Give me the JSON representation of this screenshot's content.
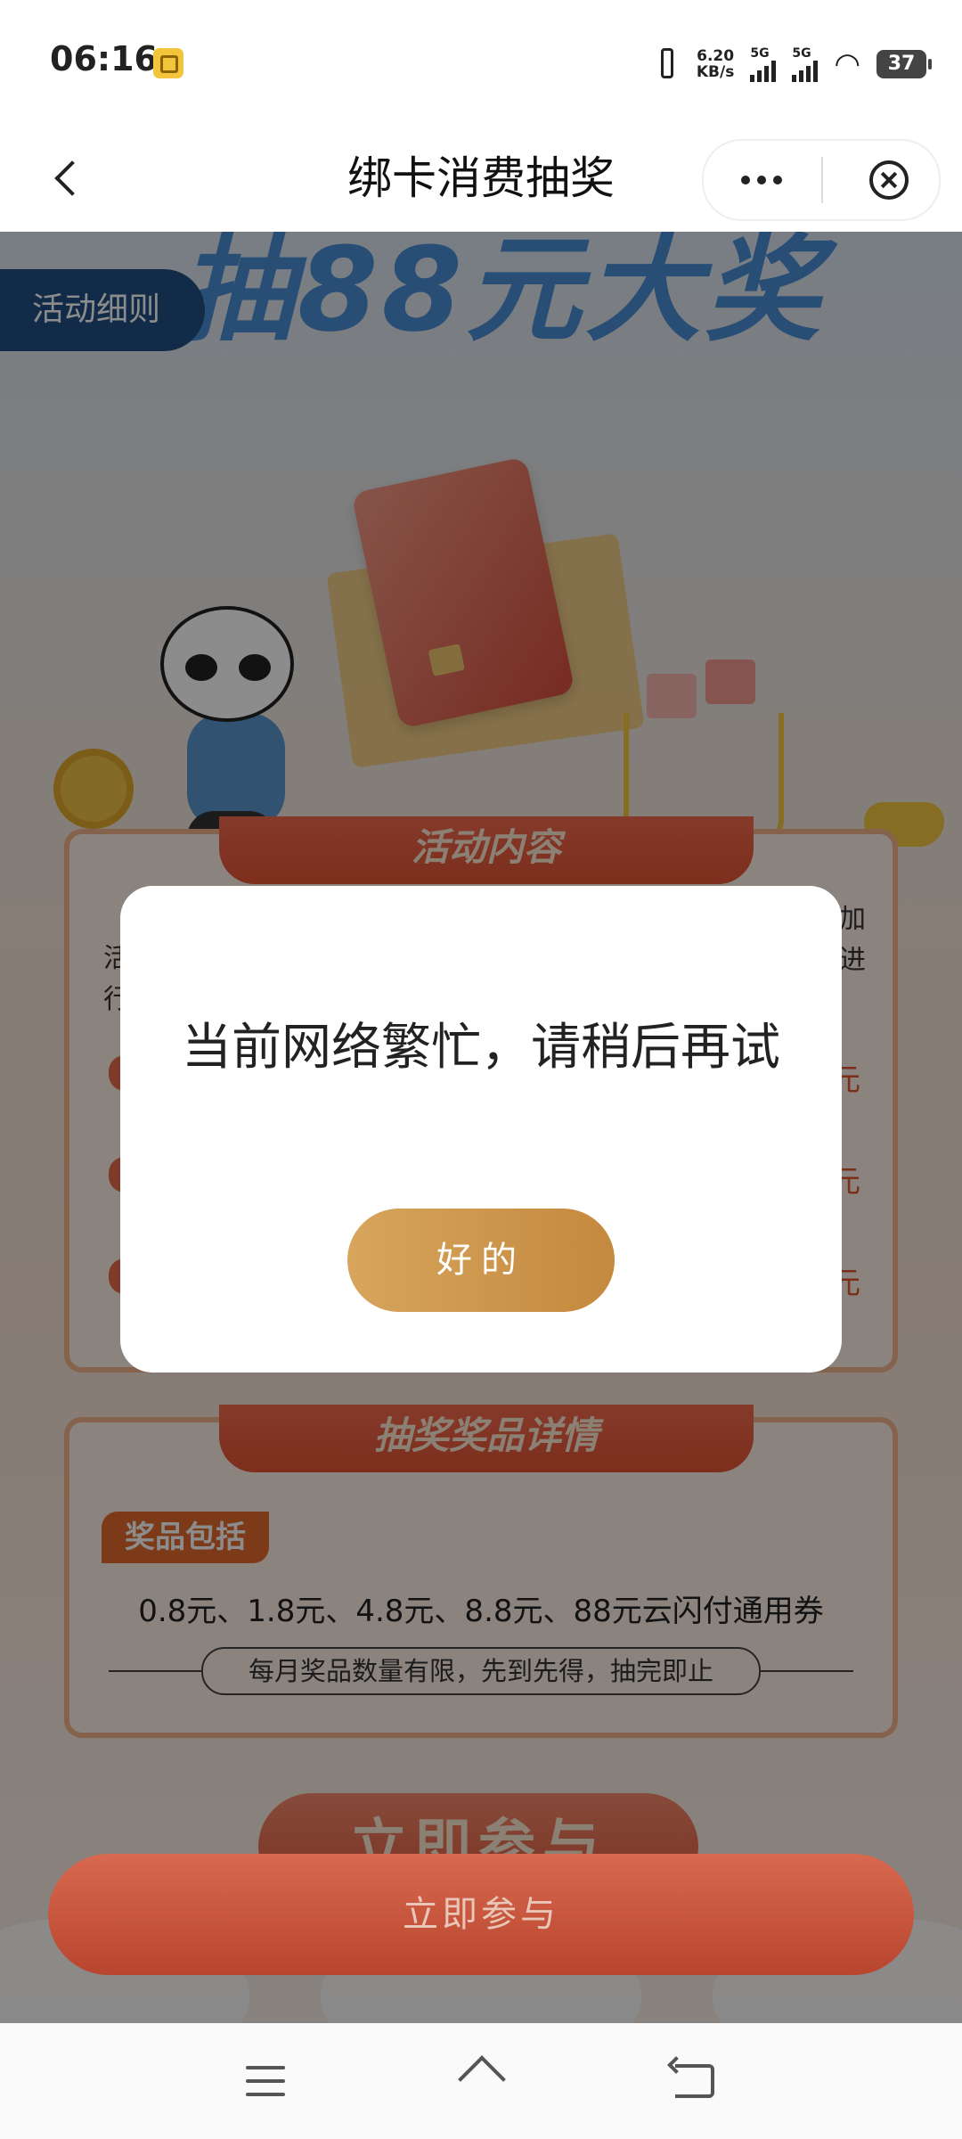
{
  "status_bar": {
    "time": "06:16",
    "net_speed_value": "6.20",
    "net_speed_unit": "KB/s",
    "sim1": "5G",
    "sim2": "5G",
    "battery": "37"
  },
  "nav": {
    "title": "绑卡消费抽奖"
  },
  "banner": {
    "title": "抽88元大奖",
    "rules_tab": "活动细则"
  },
  "activity_panel": {
    "header": "活动内容",
    "frag_left_1": "活",
    "frag_left_2": "行",
    "frag_right_1": "加",
    "frag_right_2": "进",
    "amount_suffix": "元"
  },
  "prize_panel": {
    "header": "抽奖奖品详情",
    "tag": "奖品包括",
    "prizes": "0.8元、1.8元、4.8元、8.8元、88元云闪付通用券",
    "limit_note": "每月奖品数量有限，先到先得，抽完即止"
  },
  "join_banner_text": "立即参与",
  "join_button": "立即参与",
  "dialog": {
    "message": "当前网络繁忙，请稍后再试",
    "ok_label": "好的"
  },
  "colors": {
    "dialog_button": "#c99447",
    "join_button": "#c95a40",
    "rules_tab": "#1f4f86"
  },
  "icons": [
    "back-arrow-icon",
    "more-icon",
    "close-circle-icon",
    "menu-icon",
    "home-icon",
    "back-icon"
  ]
}
